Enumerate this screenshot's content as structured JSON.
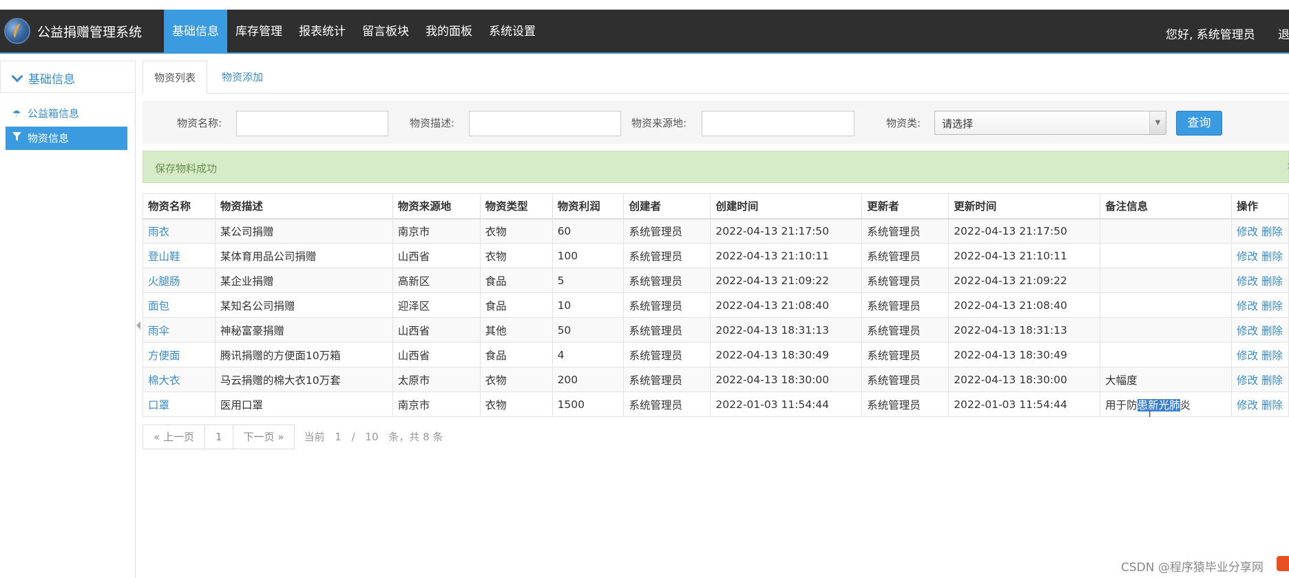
{
  "header": {
    "brand": "公益捐赠管理系统",
    "nav": [
      "基础信息",
      "库存管理",
      "报表统计",
      "留言板块",
      "我的面板",
      "系统设置"
    ],
    "active_nav": "基础信息",
    "user_greeting": "您好, 系统管理员",
    "logout": "退出"
  },
  "sidebar": {
    "section": "基础信息",
    "items": [
      {
        "label": "公益箱信息",
        "icon": "umbrella-icon"
      },
      {
        "label": "物资信息",
        "icon": "filter-icon"
      }
    ]
  },
  "tabs": [
    "物资列表",
    "物资添加"
  ],
  "search": {
    "name_label": "物资名称:",
    "desc_label": "物资描述:",
    "source_label": "物资来源地:",
    "type_label": "物资类:",
    "type_value": "请选择",
    "query_button": "查询"
  },
  "alert": "保存物料成功",
  "table": {
    "headers": [
      "物资名称",
      "物资描述",
      "物资来源地",
      "物资类型",
      "物资利润",
      "创建者",
      "创建时间",
      "更新者",
      "更新时间",
      "备注信息",
      "操作"
    ],
    "edit_label": "修改",
    "delete_label": "删除",
    "rows": [
      [
        "雨衣",
        "某公司捐赠",
        "南京市",
        "衣物",
        "60",
        "系统管理员",
        "2022-04-13 21:17:50",
        "系统管理员",
        "2022-04-13 21:17:50",
        ""
      ],
      [
        "登山鞋",
        "某体育用品公司捐赠",
        "山西省",
        "衣物",
        "100",
        "系统管理员",
        "2022-04-13 21:10:11",
        "系统管理员",
        "2022-04-13 21:10:11",
        ""
      ],
      [
        "火腿肠",
        "某企业捐赠",
        "高新区",
        "食品",
        "5",
        "系统管理员",
        "2022-04-13 21:09:22",
        "系统管理员",
        "2022-04-13 21:09:22",
        ""
      ],
      [
        "面包",
        "某知名公司捐赠",
        "迎泽区",
        "食品",
        "10",
        "系统管理员",
        "2022-04-13 21:08:40",
        "系统管理员",
        "2022-04-13 21:08:40",
        ""
      ],
      [
        "雨伞",
        "神秘富豪捐赠",
        "山西省",
        "其他",
        "50",
        "系统管理员",
        "2022-04-13 18:31:13",
        "系统管理员",
        "2022-04-13 18:31:13",
        ""
      ],
      [
        "方便面",
        "腾讯捐赠的方便面10万箱",
        "山西省",
        "食品",
        "4",
        "系统管理员",
        "2022-04-13 18:30:49",
        "系统管理员",
        "2022-04-13 18:30:49",
        ""
      ],
      [
        "棉大衣",
        "马云捐赠的棉大衣10万套",
        "太原市",
        "衣物",
        "200",
        "系统管理员",
        "2022-04-13 18:30:00",
        "系统管理员",
        "2022-04-13 18:30:00",
        "大幅度"
      ],
      [
        "口罩",
        "医用口罩",
        "南京市",
        "衣物",
        "1500",
        "系统管理员",
        "2022-01-03 11:54:44",
        "系统管理员",
        "2022-01-03 11:54:44",
        "用于防患新光肺炎"
      ]
    ],
    "last_note_parts": [
      "用于防",
      "患新光肺",
      "炎"
    ]
  },
  "pager": {
    "prev": "« 上一页",
    "page": "1",
    "next": "下一页 »",
    "current_label": "当前",
    "current": "1",
    "sep": "/",
    "size": "10",
    "suffix": "条，共 8 条"
  },
  "watermark": "CSDN @程序猿毕业分享网"
}
